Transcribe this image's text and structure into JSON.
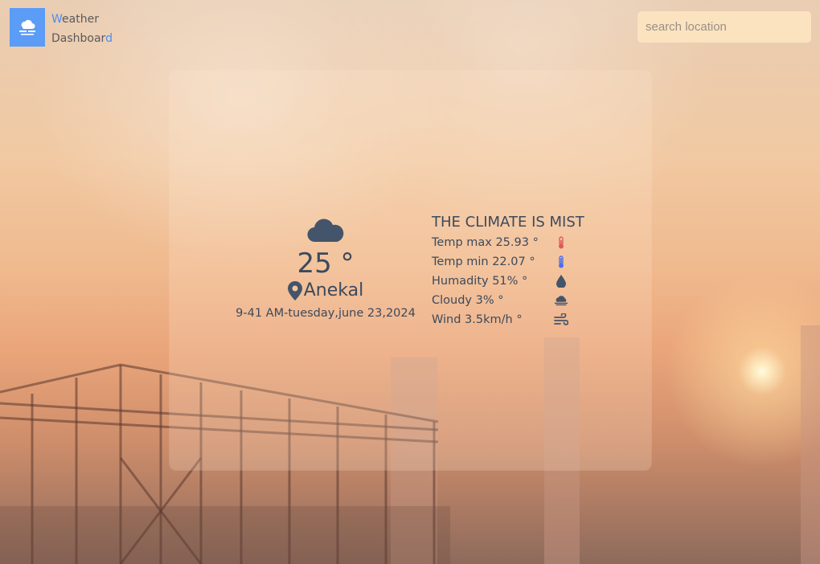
{
  "brand": {
    "line1_first": "W",
    "line1_rest": "eather",
    "line2_main": "Dashboar",
    "line2_last": "d"
  },
  "search": {
    "placeholder": "search location"
  },
  "weather": {
    "temperature": "25 °",
    "location": "Anekal",
    "datetime": "9-41 AM-tuesday,june 23,2024",
    "climate": "THE CLIMATE IS MIST",
    "details": [
      {
        "label": "Temp max 25.93 °",
        "icon": "thermometer-hot-icon"
      },
      {
        "label": "Temp min 22.07 °",
        "icon": "thermometer-cold-icon"
      },
      {
        "label": "Humadity 51% °",
        "icon": "droplet-icon"
      },
      {
        "label": "Cloudy 3% °",
        "icon": "cloud-icon"
      },
      {
        "label": "Wind 3.5km/h °",
        "icon": "wind-icon"
      }
    ]
  },
  "colors": {
    "accent": "#5b9cf6",
    "text": "#3c4a5c",
    "search_bg": "#fbe3c0",
    "hot": "#e05a5a",
    "cold": "#4a6ef0"
  }
}
